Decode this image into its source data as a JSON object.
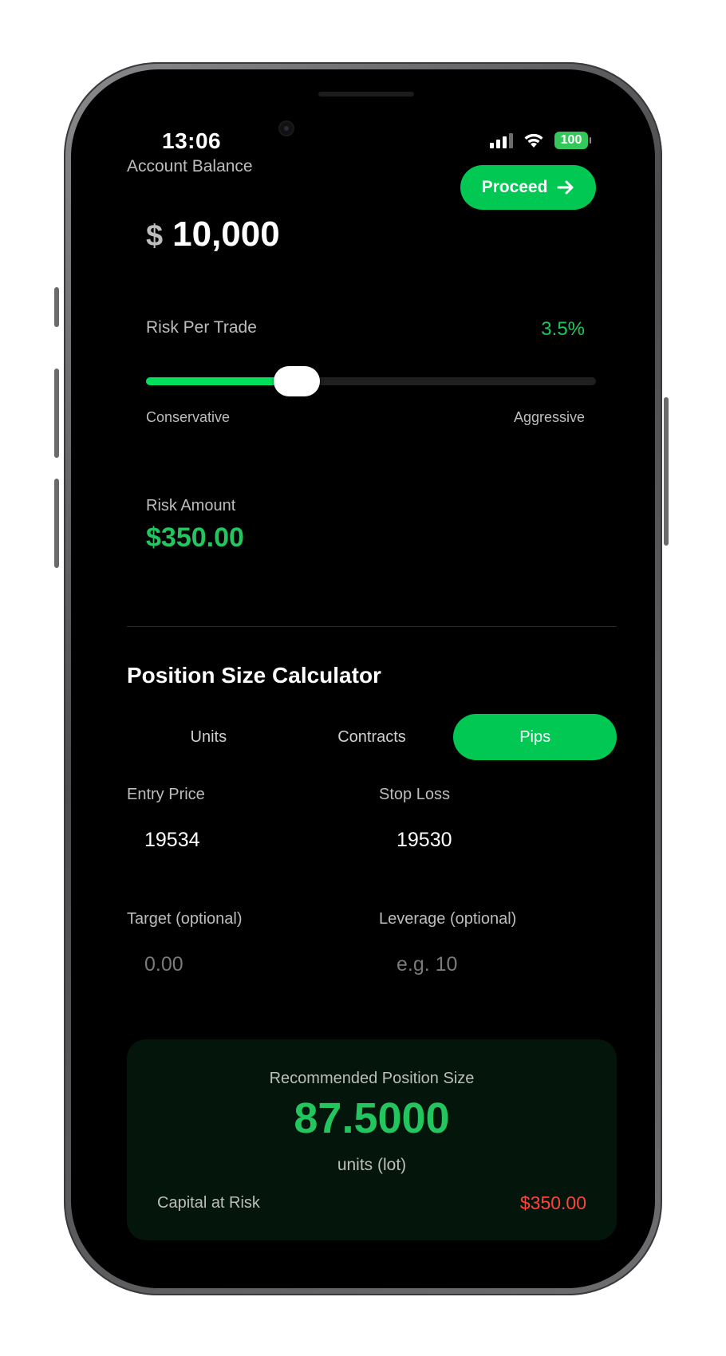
{
  "status_bar": {
    "time": "13:06",
    "battery": "100",
    "icons": [
      "signal-icon",
      "wifi-icon",
      "battery-icon"
    ]
  },
  "account": {
    "label": "Account Balance",
    "currency_symbol": "$",
    "balance": "10,000"
  },
  "proceed_button": {
    "label": "Proceed",
    "icon": "arrow-right-icon"
  },
  "risk": {
    "label": "Risk Per Trade",
    "percent_text": "3.5%",
    "slider_fraction": 0.335,
    "min_label": "Conservative",
    "max_label": "Aggressive",
    "amount_label": "Risk Amount",
    "amount": "$350.00"
  },
  "calculator": {
    "title": "Position Size Calculator",
    "tabs": [
      {
        "label": "Units",
        "active": false
      },
      {
        "label": "Contracts",
        "active": false
      },
      {
        "label": "Pips",
        "active": true
      }
    ],
    "entry_price": {
      "label": "Entry Price",
      "value": "19534",
      "placeholder": ""
    },
    "stop_loss": {
      "label": "Stop Loss",
      "value": "19530",
      "placeholder": ""
    },
    "target": {
      "label": "Target (optional)",
      "value": "",
      "placeholder": "0.00"
    },
    "leverage": {
      "label": "Leverage (optional)",
      "value": "",
      "placeholder": "e.g. 10"
    }
  },
  "result": {
    "title": "Recommended Position Size",
    "value": "87.5000",
    "unit": "units (lot)",
    "capital_label": "Capital at Risk",
    "capital_value": "$350.00"
  },
  "colors": {
    "accent_green": "#00c853",
    "text_green": "#22c55e",
    "risk_red": "#ff453a",
    "background": "#000000",
    "card_background": "#04160b"
  }
}
